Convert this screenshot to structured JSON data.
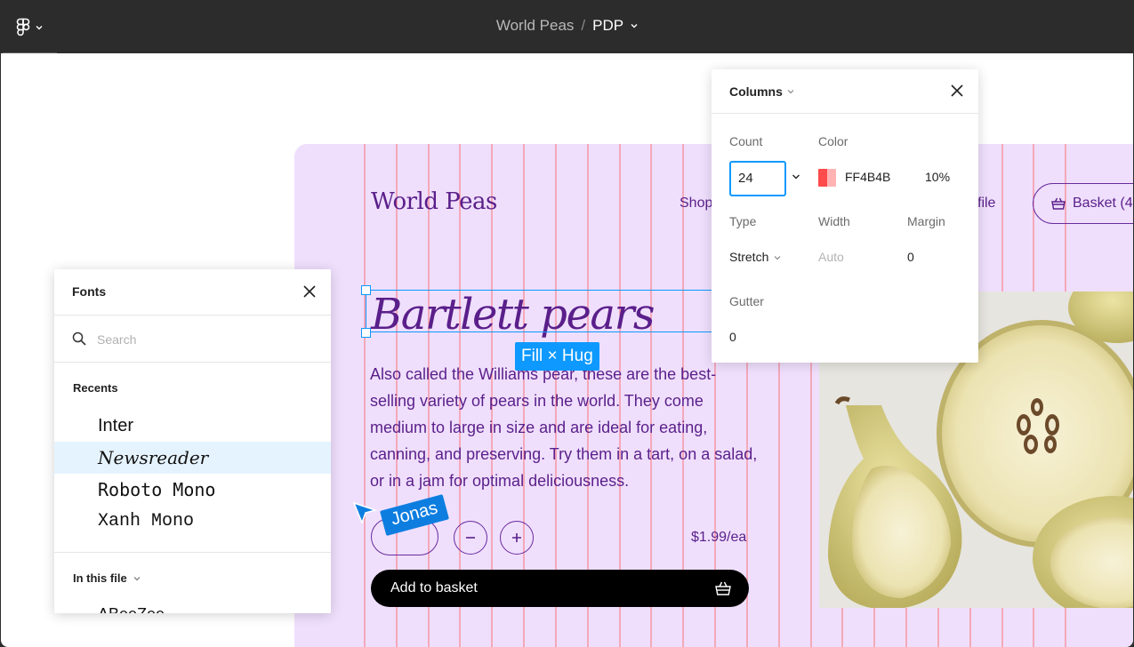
{
  "topbar": {
    "project": "World Peas",
    "separator": "/",
    "page": "PDP"
  },
  "site": {
    "brand": "World Peas",
    "nav_shop": "Shop",
    "nav_profile_partial": "file",
    "basket_label": "Basket (4",
    "heading": "Bartlett pears",
    "size_badge": "Fill × Hug",
    "description": "Also called the Williams pear, these are the best-selling variety of pears in the world. They come medium to large in size and are ideal for eating, canning, and preserving. Try them in a tart, on a salad, or in a jam for optimal deliciousness.",
    "price": "$1.99/ea",
    "add_to_basket": "Add to basket",
    "brand_color": "#5a1f8a",
    "frame_bg": "#efdffd"
  },
  "cursor": {
    "user": "Jonas"
  },
  "fonts_panel": {
    "title": "Fonts",
    "search_placeholder": "Search",
    "recents_label": "Recents",
    "recents": [
      "Inter",
      "Newsreader",
      "Roboto Mono",
      "Xanh Mono"
    ],
    "selected_font": "Newsreader",
    "in_this_file_label": "In this file",
    "in_this_file_first": "ABeeZee"
  },
  "columns_panel": {
    "title": "Columns",
    "count_label": "Count",
    "count_value": "24",
    "color_label": "Color",
    "color_hex": "FF4B4B",
    "opacity": "10%",
    "type_label": "Type",
    "type_value": "Stretch",
    "width_label": "Width",
    "width_value": "Auto",
    "margin_label": "Margin",
    "margin_value": "0",
    "gutter_label": "Gutter",
    "gutter_value": "0",
    "grid_color": "#ff4b4b"
  }
}
